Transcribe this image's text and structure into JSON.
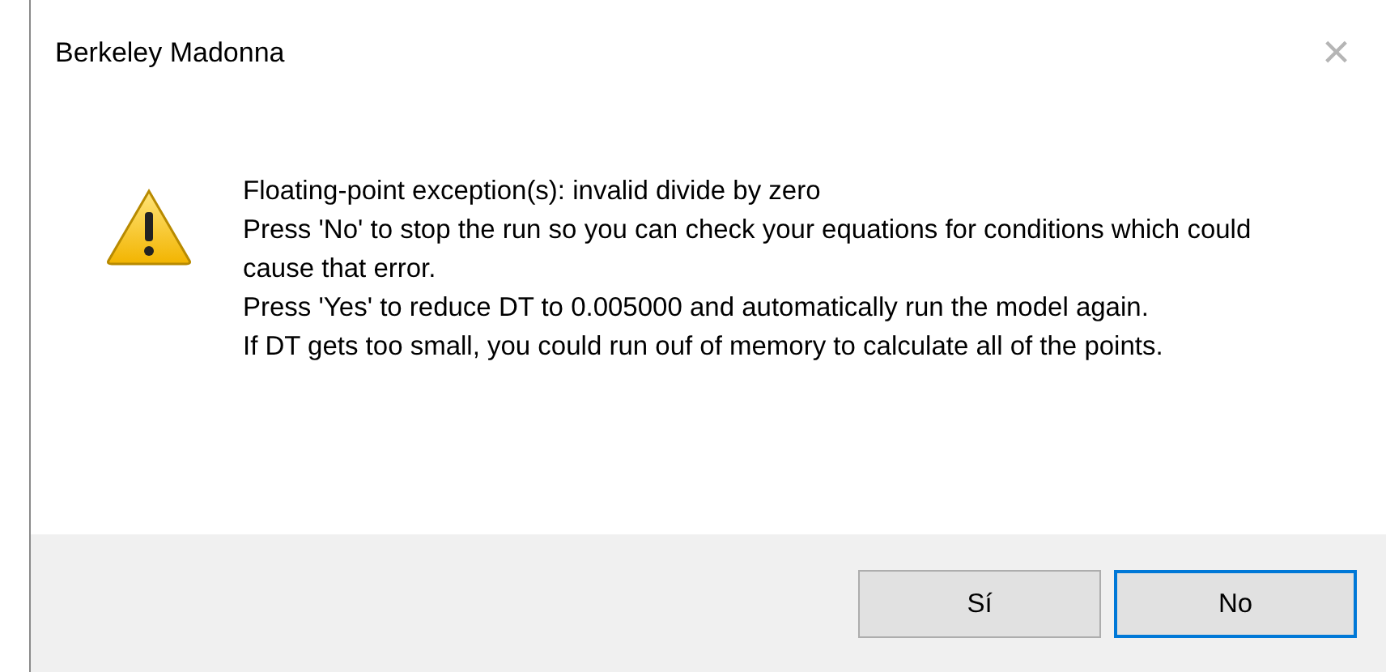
{
  "window": {
    "title": "Berkeley Madonna",
    "close": "×"
  },
  "message": {
    "paragraphs": [
      "Floating-point exception(s): invalid divide by zero",
      "Press 'No' to stop the run so you can check your equations for conditions which could cause that error.",
      "Press 'Yes' to reduce DT to 0.005000 and automatically run the model again.",
      "If DT gets too small, you could run ouf of memory to calculate all of the points."
    ]
  },
  "buttons": [
    {
      "label": "Sí",
      "default": false
    },
    {
      "label": "No",
      "default": true
    }
  ]
}
